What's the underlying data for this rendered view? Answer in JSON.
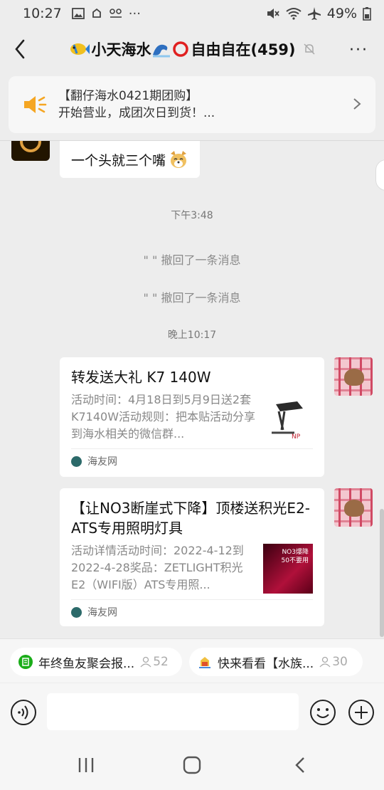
{
  "status": {
    "time": "10:27",
    "battery": "49%"
  },
  "header": {
    "title": "小天海水",
    "title2": "自由自在(459)",
    "more": "···"
  },
  "notice": {
    "line1": "【翻仔海水0421期团购】",
    "line2": "开始营业，成团次日到货！..."
  },
  "messages": {
    "bubble_text": "一个头就三个嘴",
    "time1": "下午3:48",
    "recall1": "\"              \" 撤回了一条消息",
    "recall2": "\"              \" 撤回了一条消息",
    "time2": "晚上10:17"
  },
  "cards": [
    {
      "title": "转发送大礼 K7 140W",
      "desc": "活动时间：4月18日到5月9日送2套K7140W活动规则：把本贴活动分享到海水相关的微信群...",
      "source": "海友网"
    },
    {
      "title": "【让NO3断崖式下降】顶楼送积光E2-ATS专用照明灯具",
      "desc": "活动详情活动时间：2022-4-12到2022-4-28奖品：ZETLIGHT积光E2（WIFI版）ATS专用照...",
      "source": "海友网",
      "thumb_text1": "NO3爆降",
      "thumb_text2": "50不要用"
    }
  ],
  "group_tabs": [
    {
      "label": "年终鱼友聚会报...",
      "count": "52"
    },
    {
      "label": "快来看看【水族...",
      "count": "30"
    }
  ],
  "colors": {
    "background": "#ededed",
    "card": "#ffffff",
    "notice_icon": "#f5a623",
    "tab_icon_green": "#1aad19"
  }
}
